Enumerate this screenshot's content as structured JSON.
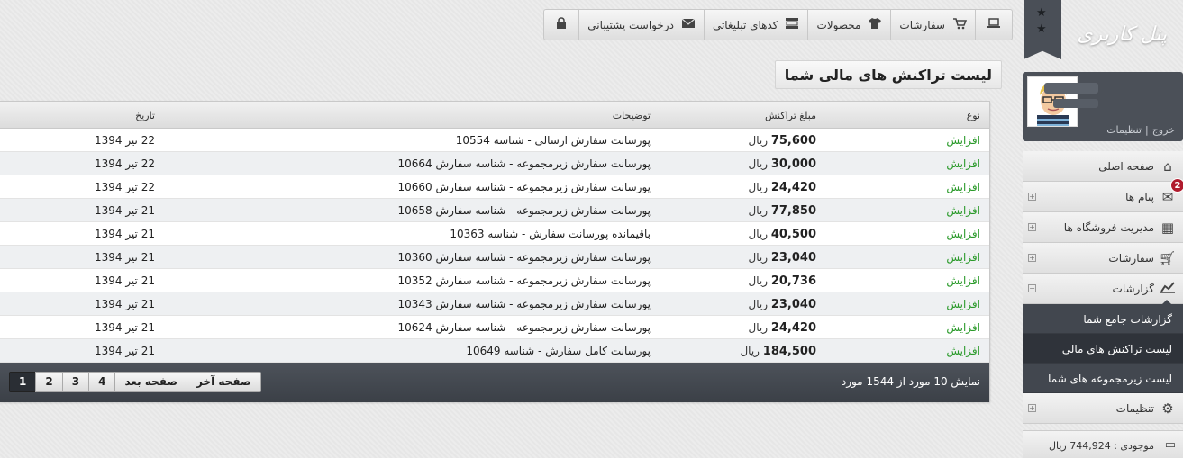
{
  "sidebar": {
    "brand": "پنل کاربری",
    "profile": {
      "settings_link": "تنظیمات",
      "logout_link": "خروج",
      "separator": "|"
    },
    "menu": [
      {
        "label": "صفحه اصلی",
        "icon": "home-icon"
      },
      {
        "label": "پیام ها",
        "icon": "envelope-icon",
        "badge": "2"
      },
      {
        "label": "مدیریت فروشگاه ها",
        "icon": "grid-icon"
      },
      {
        "label": "سفارشات",
        "icon": "cart-icon"
      },
      {
        "label": "گزارشات",
        "icon": "chart-icon"
      },
      {
        "label": "تنظیمات",
        "icon": "gear-icon"
      }
    ],
    "submenu": [
      {
        "label": "گزارشات جامع شما"
      },
      {
        "label": "لیست تراکنش های مالی"
      },
      {
        "label": "لیست زیرمجموعه های شما"
      }
    ],
    "balance": "موجودی : 744,924 ریال"
  },
  "toolbar": {
    "orders": "سفارشات",
    "products": "محصولات",
    "promo_codes": "کدهای تبلیغاتی",
    "support": "درخواست پشتیبانی"
  },
  "page_title": "لیست تراکنش های مالی شما",
  "table": {
    "headers": {
      "type": "نوع",
      "amount": "مبلغ تراکنش",
      "desc": "توضیحات",
      "date": "تاریخ"
    },
    "currency": "ریال",
    "rows": [
      {
        "type": "افزایش",
        "amount": "75,600",
        "desc": "پورسانت سفارش ارسالی - شناسه 10554",
        "date": "22 تیر 1394"
      },
      {
        "type": "افزایش",
        "amount": "30,000",
        "desc": "پورسانت سفارش زیرمجموعه - شناسه سفارش 10664",
        "date": "22 تیر 1394"
      },
      {
        "type": "افزایش",
        "amount": "24,420",
        "desc": "پورسانت سفارش زیرمجموعه - شناسه سفارش 10660",
        "date": "22 تیر 1394"
      },
      {
        "type": "افزایش",
        "amount": "77,850",
        "desc": "پورسانت سفارش زیرمجموعه - شناسه سفارش 10658",
        "date": "21 تیر 1394"
      },
      {
        "type": "افزایش",
        "amount": "40,500",
        "desc": "باقیمانده پورسانت سفارش - شناسه 10363",
        "date": "21 تیر 1394"
      },
      {
        "type": "افزایش",
        "amount": "23,040",
        "desc": "پورسانت سفارش زیرمجموعه - شناسه سفارش 10360",
        "date": "21 تیر 1394"
      },
      {
        "type": "افزایش",
        "amount": "20,736",
        "desc": "پورسانت سفارش زیرمجموعه - شناسه سفارش 10352",
        "date": "21 تیر 1394"
      },
      {
        "type": "افزایش",
        "amount": "23,040",
        "desc": "پورسانت سفارش زیرمجموعه - شناسه سفارش 10343",
        "date": "21 تیر 1394"
      },
      {
        "type": "افزایش",
        "amount": "24,420",
        "desc": "پورسانت سفارش زیرمجموعه - شناسه سفارش 10624",
        "date": "21 تیر 1394"
      },
      {
        "type": "افزایش",
        "amount": "184,500",
        "desc": "پورسانت کامل سفارش - شناسه 10649",
        "date": "21 تیر 1394"
      }
    ],
    "footer_info": "نمایش 10 مورد از 1544 مورد",
    "pager": {
      "last": "صفحه آخر",
      "next": "صفحه بعد",
      "pages": [
        "4",
        "3",
        "2",
        "1"
      ],
      "current": "1"
    }
  },
  "colors": {
    "increase": "#2a9a2a",
    "dark_panel": "#42474f",
    "badge": "#b01c2e"
  }
}
